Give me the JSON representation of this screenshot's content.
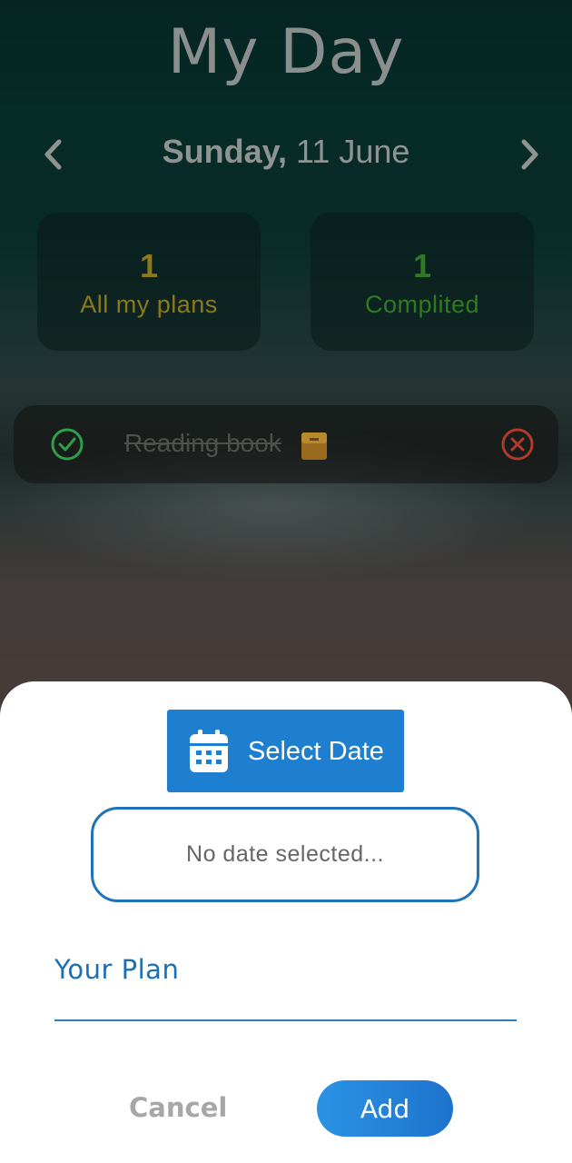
{
  "header": {
    "title": "My Day"
  },
  "date_nav": {
    "weekday": "Sunday,",
    "date": "11 June"
  },
  "stats": [
    {
      "count": "1",
      "label": "All my plans",
      "color": "#8a7a1e"
    },
    {
      "count": "1",
      "label": "Complited",
      "color": "#2f7a25"
    }
  ],
  "plans": [
    {
      "text": "Reading book",
      "status": "completed",
      "emoji_icon": "book-icon"
    }
  ],
  "sheet": {
    "select_date_label": "Select Date",
    "date_display": "No date selected...",
    "plan_placeholder": "Your Plan",
    "cancel_label": "Cancel",
    "add_label": "Add"
  },
  "colors": {
    "primary": "#1e7fd0",
    "check_green": "#2ea04a",
    "remove_red": "#b03a2e"
  }
}
